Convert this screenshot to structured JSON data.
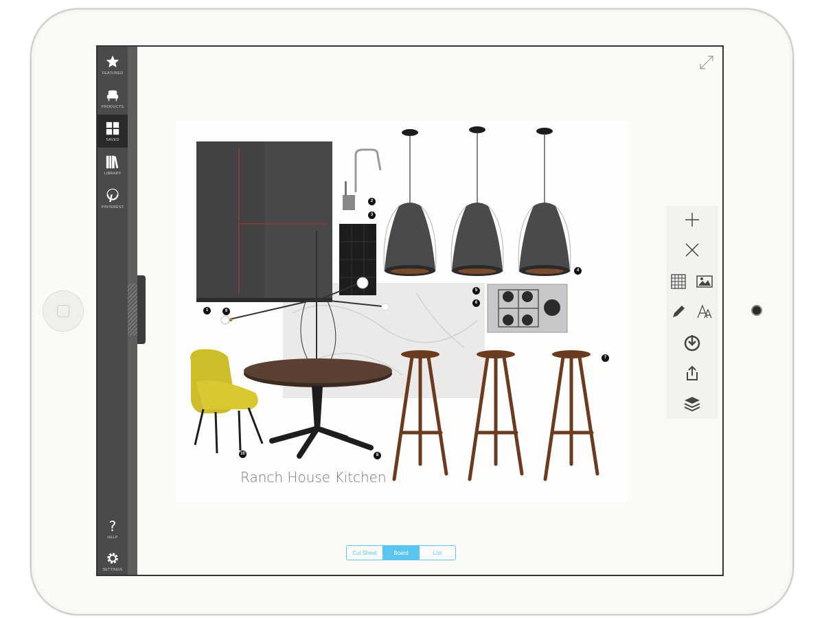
{
  "sidebar": {
    "items": [
      {
        "label": "FEATURED",
        "icon": "star-icon"
      },
      {
        "label": "PRODUCTS",
        "icon": "chair-icon"
      },
      {
        "label": "SAVED",
        "icon": "grid-icon"
      },
      {
        "label": "LIBRARY",
        "icon": "books-icon"
      },
      {
        "label": "PINTEREST",
        "icon": "pinterest-icon"
      }
    ],
    "bottom": [
      {
        "label": "HELP",
        "icon": "help-icon"
      },
      {
        "label": "SETTINGS",
        "icon": "gear-icon"
      }
    ],
    "active": "SAVED"
  },
  "board": {
    "title": "Ranch House Kitchen",
    "tags": [
      "1",
      "2",
      "3",
      "4",
      "5",
      "6",
      "7",
      "8",
      "9",
      "10"
    ]
  },
  "toolbar": {
    "buttons": [
      "plus-icon",
      "close-icon",
      "table-icon",
      "image-icon",
      "pencil-icon",
      "text-icon",
      "download-icon",
      "share-icon",
      "layers-icon"
    ]
  },
  "view_toggle": {
    "options": [
      "Cut Sheet",
      "Board",
      "List"
    ],
    "selected": "Board"
  },
  "colors": {
    "accent": "#5bc4ee",
    "sidebar": "#4a4a4a",
    "frame": "#fbfaf6"
  }
}
